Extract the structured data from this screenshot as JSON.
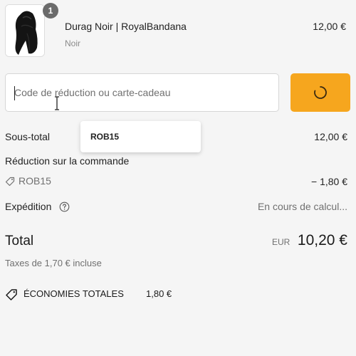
{
  "product": {
    "quantity": "1",
    "name": "Durag Noir | RoyalBandana",
    "variant": "Noir",
    "price": "12,00 €"
  },
  "discount": {
    "placeholder": "Code de réduction ou carte-cadeau",
    "value": "",
    "apply_state": "loading"
  },
  "autocomplete": {
    "suggestion": "ROB15"
  },
  "summary": {
    "subtotal_label": "Sous-total",
    "subtotal_value": "12,00 €",
    "order_discount_label": "Réduction sur la commande",
    "discount_code": "ROB15",
    "discount_amount": "− 1,80 €",
    "shipping_label": "Expédition",
    "shipping_value": "En cours de calcul...",
    "total_label": "Total",
    "currency": "EUR",
    "total_value": "10,20 €",
    "tax_note": "Taxes de 1,70 € incluse",
    "savings_label": "ÉCONOMIES TOTALES",
    "savings_value": "1,80 €"
  },
  "colors": {
    "accent": "#f6a61e",
    "background": "#f5f5f5",
    "muted_text": "#707070"
  },
  "icons": {
    "tag": "tag-icon",
    "help": "help-circle-icon",
    "savings": "savings-tag-icon",
    "spinner": "loading-spinner-icon"
  }
}
